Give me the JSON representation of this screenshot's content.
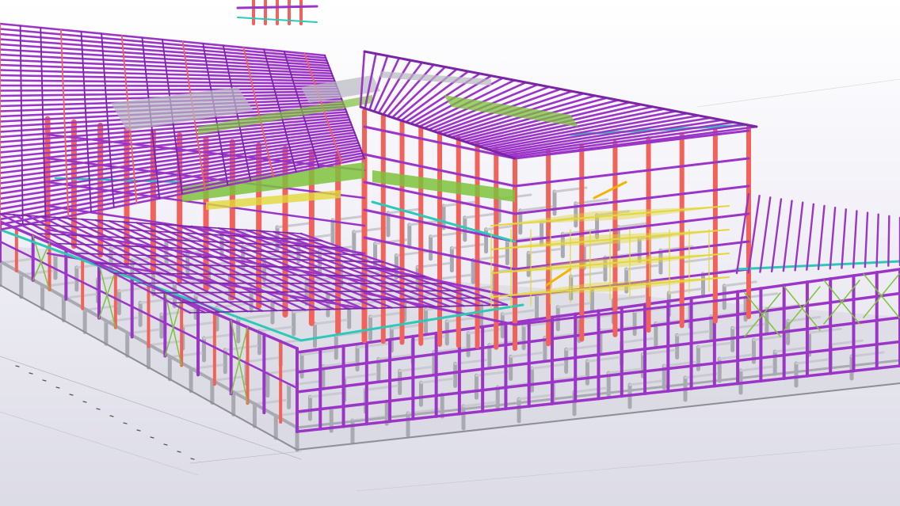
{
  "scene": {
    "subject": "3d-steel-structure-model",
    "colors": {
      "background_top": "#ffffff",
      "background_bottom": "#dcdbe6",
      "purple_beam": "#9b35c7",
      "purple_dark": "#7a24a6",
      "red_column": "#f0625a",
      "cyan_brace": "#2ec7b8",
      "green_floor": "#7ec23c",
      "yellow_platform": "#e2d83a",
      "gray_foundation": "#a9a9b2",
      "gray_light": "#c9c9d0"
    }
  }
}
